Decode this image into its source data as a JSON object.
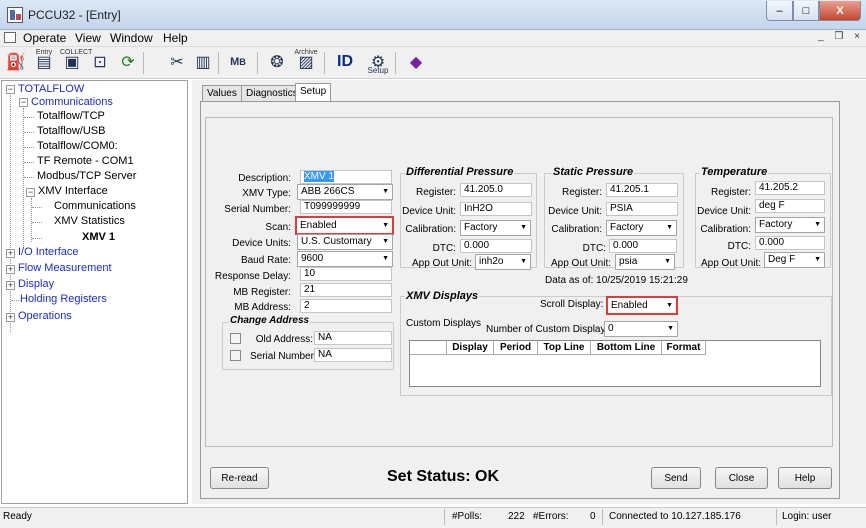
{
  "window": {
    "title": "PCCU32 - [Entry]",
    "min": "–",
    "max": "□",
    "close": "X"
  },
  "menu": [
    "Operate",
    "View",
    "Window",
    "Help"
  ],
  "mdi": "_ ❒ ×",
  "toolbar": [
    {
      "name": "entry",
      "top": "Entry"
    },
    {
      "name": "collect",
      "top": "COLLECT"
    },
    {
      "name": "calibrate",
      "top": ""
    },
    {
      "name": "refresh",
      "top": ""
    },
    {
      "name": "tools",
      "top": ""
    },
    {
      "name": "monitor",
      "top": ""
    },
    {
      "name": "mb",
      "top": ""
    },
    {
      "name": "stats",
      "top": ""
    },
    {
      "name": "archive",
      "top": "Archive"
    },
    {
      "name": "id",
      "top": ""
    },
    {
      "name": "setup",
      "top": "",
      "bottom": "Setup"
    },
    {
      "name": "help-book",
      "top": ""
    }
  ],
  "tree": {
    "root": "TOTALFLOW",
    "communications": "Communications",
    "tcp": "Totalflow/TCP",
    "usb": "Totalflow/USB",
    "com0": "Totalflow/COM0:",
    "tfremote": "TF Remote - COM1",
    "modbus": "Modbus/TCP Server",
    "xmv": "XMV Interface",
    "xmv_comm": "Communications",
    "xmv_stats": "XMV Statistics",
    "xmv1": "XMV 1",
    "io": "I/O Interface",
    "flow": "Flow Measurement",
    "display": "Display",
    "holding": "Holding Registers",
    "operations": "Operations"
  },
  "tabs": [
    "Values",
    "Diagnostics",
    "Setup"
  ],
  "setup": {
    "description_label": "Description:",
    "description": "XMV 1",
    "xmv_type_label": "XMV Type:",
    "xmv_type": "ABB 266CS",
    "serial_label": "Serial Number:",
    "serial": "T099999999",
    "scan_label": "Scan:",
    "scan": "Enabled",
    "units_label": "Device Units:",
    "units": "U.S. Customary",
    "baud_label": "Baud Rate:",
    "baud": "9600",
    "response_label": "Response Delay:",
    "response": "10",
    "mbreg_label": "MB Register:",
    "mbreg": "21",
    "mbaddr_label": "MB Address:",
    "mbaddr": "2"
  },
  "change_address": {
    "title": "Change Address",
    "old_label": "Old Address:",
    "old": "NA",
    "serial_label": "Serial Number:",
    "serial": "NA"
  },
  "dp": {
    "title": "Differential Pressure",
    "register_label": "Register:",
    "register": "41.205.0",
    "unit_label": "Device Unit:",
    "unit": "InH2O",
    "cal_label": "Calibration:",
    "cal": "Factory",
    "dtc_label": "DTC:",
    "dtc": "0.000",
    "out_label": "App Out Unit:",
    "out": "inh2o"
  },
  "sp": {
    "title": "Static Pressure",
    "register_label": "Register:",
    "register": "41.205.1",
    "unit_label": "Device Unit:",
    "unit": "PSIA",
    "cal_label": "Calibration:",
    "cal": "Factory",
    "dtc_label": "DTC:",
    "dtc": "0.000",
    "out_label": "App Out Unit:",
    "out": "psia"
  },
  "temp": {
    "title": "Temperature",
    "register_label": "Register:",
    "register": "41.205.2",
    "unit_label": "Device Unit:",
    "unit": "deg F",
    "cal_label": "Calibration:",
    "cal": "Factory",
    "dtc_label": "DTC:",
    "dtc": "0.000",
    "out_label": "App Out Unit:",
    "out": "Deg F"
  },
  "data_as_of": "Data as of: 10/25/2019 15:21:29",
  "displays": {
    "title": "XMV Displays",
    "scroll_label": "Scroll Display:",
    "scroll": "Enabled",
    "custom_label": "Custom Displays",
    "num_label": "Number of Custom Displays:",
    "num": "0",
    "columns": [
      "Display",
      "Period",
      "Top Line",
      "Bottom Line",
      "Format"
    ]
  },
  "footer": {
    "reread": "Re-read",
    "status": "Set Status: OK",
    "send": "Send",
    "close": "Close",
    "help": "Help"
  },
  "statusbar": {
    "ready": "Ready",
    "polls_label": "#Polls:",
    "polls": "222",
    "errors_label": "#Errors:",
    "errors": "0",
    "connected": "Connected to 10.127.185.176",
    "login": "Login: user"
  },
  "colors": {
    "highlight": "#e03a3a",
    "tree_link": "#1c2bd0"
  }
}
